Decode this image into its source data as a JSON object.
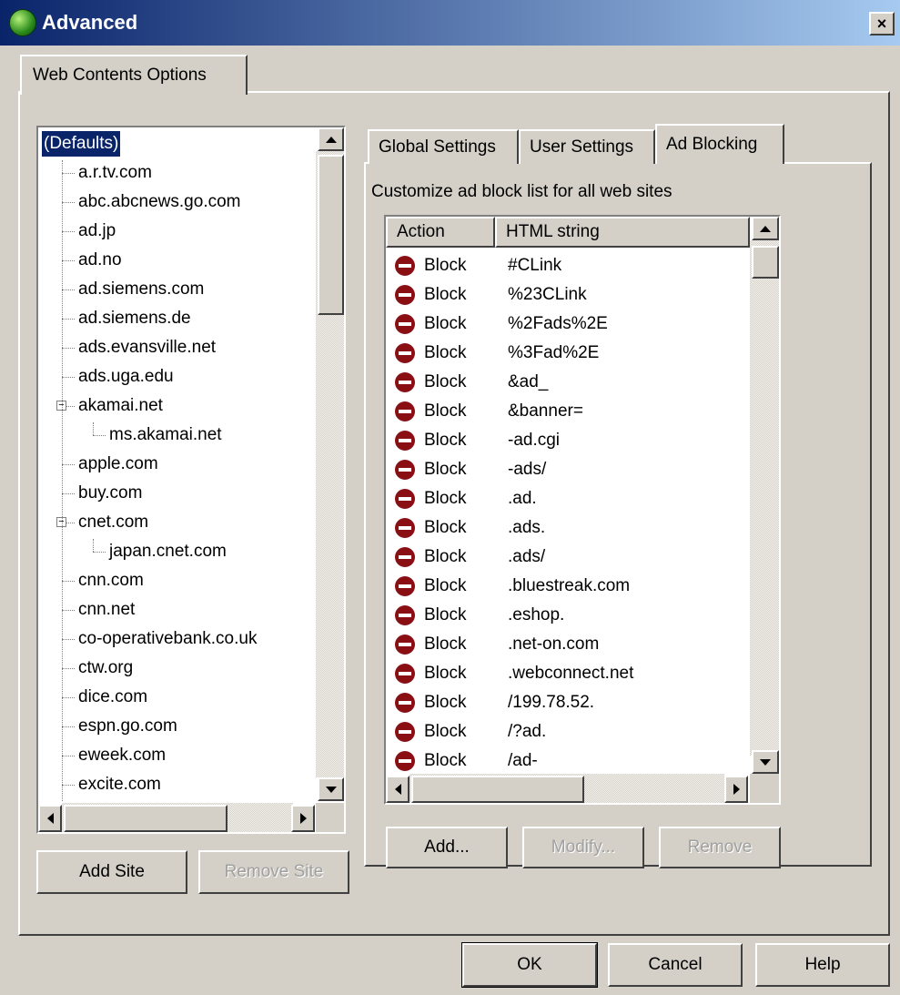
{
  "window": {
    "title": "Advanced",
    "close_label": "×"
  },
  "outer_tab": "Web Contents Options",
  "sites_tree": {
    "items": [
      {
        "label": "(Defaults)",
        "level": 0,
        "selected": true
      },
      {
        "label": "a.r.tv.com",
        "level": 1
      },
      {
        "label": "abc.abcnews.go.com",
        "level": 1
      },
      {
        "label": "ad.jp",
        "level": 1
      },
      {
        "label": "ad.no",
        "level": 1
      },
      {
        "label": "ad.siemens.com",
        "level": 1
      },
      {
        "label": "ad.siemens.de",
        "level": 1
      },
      {
        "label": "ads.evansville.net",
        "level": 1
      },
      {
        "label": "ads.uga.edu",
        "level": 1
      },
      {
        "label": "akamai.net",
        "level": 1,
        "expanded": true
      },
      {
        "label": "ms.akamai.net",
        "level": 2
      },
      {
        "label": "apple.com",
        "level": 1
      },
      {
        "label": "buy.com",
        "level": 1
      },
      {
        "label": "cnet.com",
        "level": 1,
        "expanded": true
      },
      {
        "label": "japan.cnet.com",
        "level": 2
      },
      {
        "label": "cnn.com",
        "level": 1
      },
      {
        "label": "cnn.net",
        "level": 1
      },
      {
        "label": "co-operativebank.co.uk",
        "level": 1
      },
      {
        "label": "ctw.org",
        "level": 1
      },
      {
        "label": "dice.com",
        "level": 1
      },
      {
        "label": "espn.go.com",
        "level": 1
      },
      {
        "label": "eweek.com",
        "level": 1
      },
      {
        "label": "excite.com",
        "level": 1
      }
    ]
  },
  "site_buttons": {
    "add": "Add Site",
    "remove": "Remove Site"
  },
  "inner_tabs": [
    {
      "label": "Global Settings",
      "active": false
    },
    {
      "label": "User Settings",
      "active": false
    },
    {
      "label": "Ad Blocking",
      "active": true
    }
  ],
  "ad_blocking": {
    "description": "Customize ad block list for all web sites",
    "columns": {
      "action": "Action",
      "html_string": "HTML string"
    },
    "rows": [
      {
        "action": "Block",
        "html_string": "#CLink"
      },
      {
        "action": "Block",
        "html_string": "%23CLink"
      },
      {
        "action": "Block",
        "html_string": "%2Fads%2E"
      },
      {
        "action": "Block",
        "html_string": "%3Fad%2E"
      },
      {
        "action": "Block",
        "html_string": "&ad_"
      },
      {
        "action": "Block",
        "html_string": "&banner="
      },
      {
        "action": "Block",
        "html_string": "-ad.cgi"
      },
      {
        "action": "Block",
        "html_string": "-ads/"
      },
      {
        "action": "Block",
        "html_string": ".ad."
      },
      {
        "action": "Block",
        "html_string": ".ads."
      },
      {
        "action": "Block",
        "html_string": ".ads/"
      },
      {
        "action": "Block",
        "html_string": ".bluestreak.com"
      },
      {
        "action": "Block",
        "html_string": ".eshop."
      },
      {
        "action": "Block",
        "html_string": ".net-on.com"
      },
      {
        "action": "Block",
        "html_string": ".webconnect.net"
      },
      {
        "action": "Block",
        "html_string": "/199.78.52."
      },
      {
        "action": "Block",
        "html_string": "/?ad."
      },
      {
        "action": "Block",
        "html_string": "/ad-"
      }
    ],
    "buttons": {
      "add": "Add...",
      "modify": "Modify...",
      "remove": "Remove"
    }
  },
  "dialog_buttons": {
    "ok": "OK",
    "cancel": "Cancel",
    "help": "Help"
  },
  "colors": {
    "selection": "#0a246a",
    "block_icon": "#8a0f14",
    "face": "#d4d0c8"
  },
  "icons": {
    "title": "globe-icon",
    "block": "no-entry-icon"
  }
}
